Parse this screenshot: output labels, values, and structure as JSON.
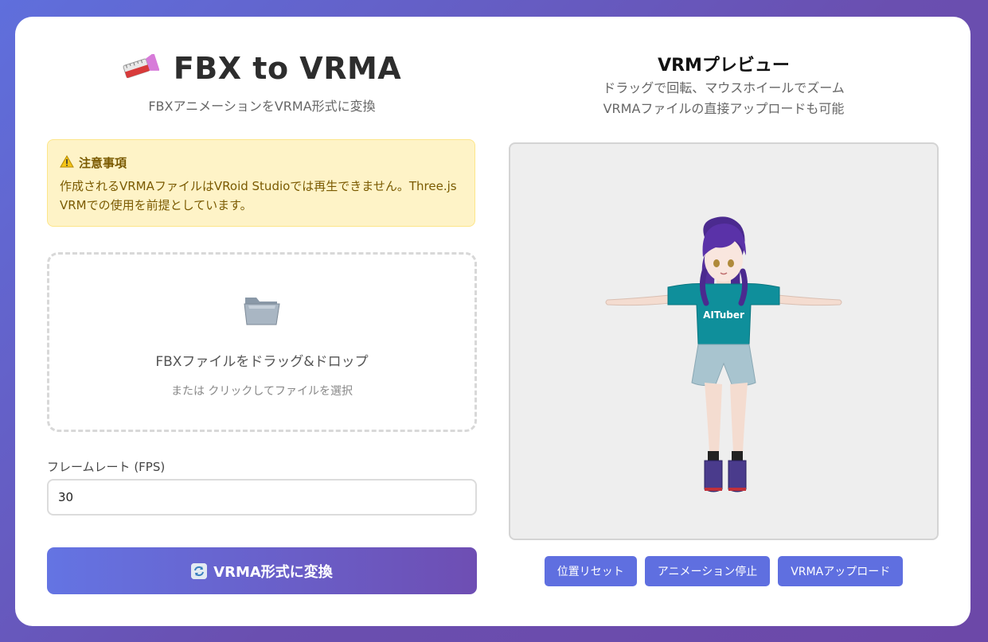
{
  "app": {
    "title": "FBX to VRMA",
    "subtitle": "FBXアニメーションをVRMA形式に変換",
    "title_icon": "ruler-icon"
  },
  "warning": {
    "icon": "warning-icon",
    "heading": "注意事項",
    "line1": "作成されるVRMAファイルはVRoid Studioでは再生できません。Three.js",
    "line2": "VRMでの使用を前提としています。"
  },
  "dropzone": {
    "icon": "folder-icon",
    "main_text": "FBXファイルをドラッグ&ドロップ",
    "sub_text": "または クリックしてファイルを選択"
  },
  "fps": {
    "label": "フレームレート (FPS)",
    "value": "30"
  },
  "convert_button": {
    "icon": "sync-icon",
    "label": "VRMA形式に変換"
  },
  "preview": {
    "title": "VRMプレビュー",
    "desc_line1": "ドラッグで回転、マウスホイールでズーム",
    "desc_line2": "VRMAファイルの直接アップロードも可能",
    "shirt_text": "AITuber",
    "buttons": {
      "reset": "位置リセット",
      "stop": "アニメーション停止",
      "upload": "VRMAアップロード"
    }
  },
  "colors": {
    "accent": "#5f6fe0",
    "gradient_start": "#6474e3",
    "gradient_end": "#6e4eb3",
    "warning_bg": "#fef3c7"
  }
}
